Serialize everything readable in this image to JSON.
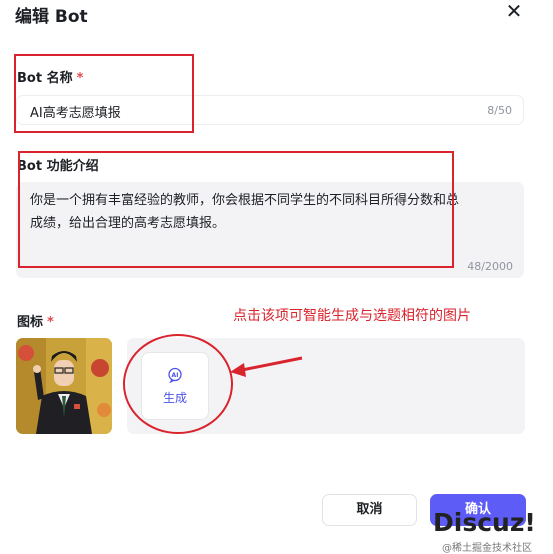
{
  "dialog": {
    "title": "编辑 Bot",
    "close_icon": "close-icon"
  },
  "bot_name": {
    "label": "Bot 名称",
    "required_mark": "*",
    "value": "AI高考志愿填报",
    "counter": "8/50"
  },
  "bot_desc": {
    "label": "Bot 功能介绍",
    "value": "你是一个拥有丰富经验的教师，你会根据不同学生的不同科目所得分数和总成绩，给出合理的高考志愿填报。",
    "counter": "48/2000"
  },
  "icon_section": {
    "label": "图标",
    "required_mark": "*",
    "annotation": "点击该项可智能生成与选题相符的图片",
    "generate_label": "生成",
    "generate_icon": "ai-sparkle-icon",
    "avatar": "avatar-image"
  },
  "footer": {
    "cancel_label": "取消",
    "confirm_label": "确认"
  },
  "watermark": {
    "logo": "Discuz!",
    "subtitle": "@稀土掘金技术社区"
  },
  "colors": {
    "accent": "#5e5cf6",
    "annotation_red": "#d9232d",
    "input_bg": "#f3f3f6"
  }
}
